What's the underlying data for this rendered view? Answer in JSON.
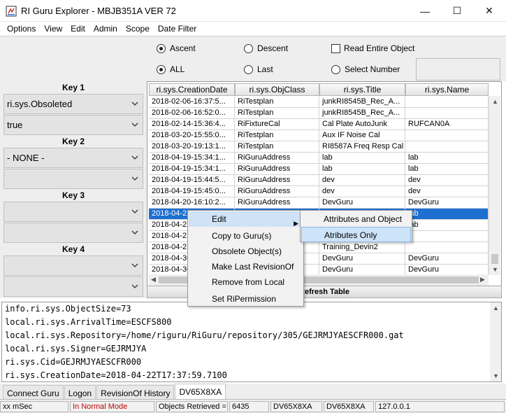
{
  "window": {
    "title": "RI Guru Explorer - MBJB351A  VER 72",
    "minimize": "—",
    "maximize": "☐",
    "close": "✕"
  },
  "menu": [
    "Options",
    "View",
    "Edit",
    "Admin",
    "Scope",
    "Date Filter"
  ],
  "controls": {
    "ascent": "Ascent",
    "descent": "Descent",
    "read_entire": "Read Entire Object",
    "all": "ALL",
    "last": "Last",
    "select_number": "Select Number"
  },
  "keys": [
    {
      "label": "Key 1",
      "values": [
        "ri.sys.Obsoleted",
        "true"
      ]
    },
    {
      "label": "Key 2",
      "values": [
        "- NONE -",
        ""
      ]
    },
    {
      "label": "Key 3",
      "values": [
        "",
        ""
      ]
    },
    {
      "label": "Key 4",
      "values": [
        "",
        ""
      ]
    }
  ],
  "table": {
    "columns": [
      "ri.sys.CreationDate",
      "ri.sys.ObjClass",
      "ri.sys.Title",
      "ri.sys.Name"
    ],
    "rows": [
      [
        "2018-02-06-16:37:5...",
        "RiTestplan",
        "junkRI8545B_Rec_A...",
        ""
      ],
      [
        "2018-02-06-16:52:0...",
        "RiTestplan",
        "junkRI8545B_Rec_A...",
        ""
      ],
      [
        "2018-02-14-15:36:4...",
        "RiFixtureCal",
        "Cal Plate AutoJunk",
        "RUFCAN0A"
      ],
      [
        "2018-03-20-15:55:0...",
        "RiTestplan",
        "Aux IF Noise Cal",
        ""
      ],
      [
        "2018-03-20-19:13:1...",
        "RiTestplan",
        "RI8587A Freq Resp Cal",
        ""
      ],
      [
        "2018-04-19-15:34:1...",
        "RiGuruAddress",
        "lab",
        "lab"
      ],
      [
        "2018-04-19-15:34:1...",
        "RiGuruAddress",
        "lab",
        "lab"
      ],
      [
        "2018-04-19-15:44:5...",
        "RiGuruAddress",
        "dev",
        "dev"
      ],
      [
        "2018-04-19-15:45:0...",
        "RiGuruAddress",
        "dev",
        "dev"
      ],
      [
        "2018-04-20-16:10:2...",
        "RiGuruAddress",
        "DevGuru",
        "DevGuru"
      ],
      [
        "2018-04-22",
        "",
        "",
        "lab"
      ],
      [
        "2018-04-22",
        "",
        "",
        "lab"
      ],
      [
        "2018-04-2",
        "",
        "",
        ""
      ],
      [
        "2018-04-2",
        "",
        "Training_Devin2",
        ""
      ],
      [
        "2018-04-30",
        "",
        "DevGuru",
        "DevGuru"
      ],
      [
        "2018-04-30",
        "",
        "DevGuru",
        "DevGuru"
      ]
    ],
    "selected_row": 10,
    "refresh_label": "Refresh Table"
  },
  "detail_lines": [
    "info.ri.sys.ObjectSize=73",
    "local.ri.sys.ArrivalTime=ESCFS800",
    "local.ri.sys.Repository=/home/riguru/RiGuru/repository/305/GEJRMJYAESCFR000.gat",
    "local.ri.sys.Signer=GEJRMJYA",
    "ri.sys.Cid=GEJRMJYAESCFR000",
    "ri.sys.CreationDate=2018-04-22T17:37:59.7100"
  ],
  "tabs": [
    "Connect Guru",
    "Logon",
    "RevisionOf History",
    "DV65X8XA"
  ],
  "status": {
    "time": "xx mSec",
    "mode": "In Normal Mode",
    "retrieved_label": "Objects Retrieved =",
    "retrieved_count": "6435",
    "host1": "DV65X8XA",
    "host2": "DV65X8XA",
    "ip": "127.0.0.1"
  },
  "context_menu": {
    "items": [
      "Edit",
      "Copy to Guru(s)",
      "Obsolete Object(s)",
      "Make Last RevisionOf",
      "Remove from Local",
      "Set RiPermission"
    ],
    "submenu": [
      "Attributes and Object",
      "Atributes Only"
    ]
  },
  "colors": {
    "selection": "#1e6fd0",
    "menu_highlight": "#cfe2f6",
    "status_mode_text": "#c00000"
  }
}
